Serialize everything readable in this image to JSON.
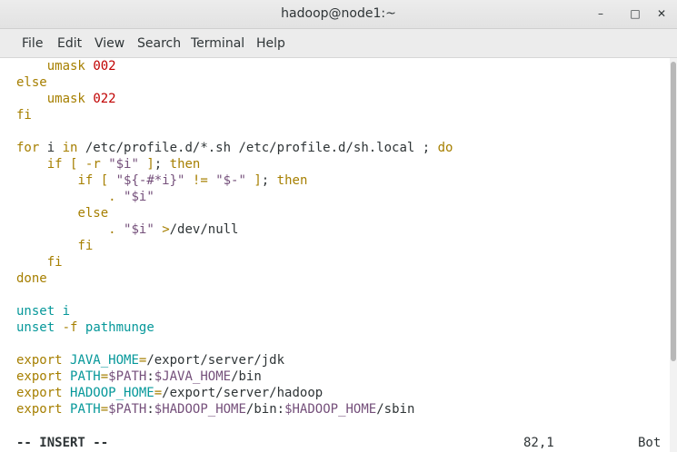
{
  "window": {
    "title": "hadoop@node1:~",
    "minimize": "–",
    "maximize": "□",
    "close": "✕"
  },
  "menu": [
    "File",
    "Edit",
    "View",
    "Search",
    "Terminal",
    "Help"
  ],
  "colors": {
    "keyword": "#a67f00",
    "builtin": "#06989a",
    "number": "#c00000",
    "string": "#75507b",
    "variable": "#75507b",
    "plain": "#2e3436"
  },
  "lines": [
    [
      {
        "t": "    "
      },
      {
        "t": "umask",
        "c": "keyword"
      },
      {
        "t": " "
      },
      {
        "t": "002",
        "c": "number"
      }
    ],
    [
      {
        "t": "else",
        "c": "keyword"
      }
    ],
    [
      {
        "t": "    "
      },
      {
        "t": "umask",
        "c": "keyword"
      },
      {
        "t": " "
      },
      {
        "t": "022",
        "c": "number"
      }
    ],
    [
      {
        "t": "fi",
        "c": "keyword"
      }
    ],
    [],
    [
      {
        "t": "for",
        "c": "keyword"
      },
      {
        "t": " i "
      },
      {
        "t": "in",
        "c": "keyword"
      },
      {
        "t": " /etc/profile.d/*.sh /etc/profile.d/sh.local ; "
      },
      {
        "t": "do",
        "c": "keyword"
      }
    ],
    [
      {
        "t": "    "
      },
      {
        "t": "if",
        "c": "keyword"
      },
      {
        "t": " "
      },
      {
        "t": "[",
        "c": "keyword"
      },
      {
        "t": " "
      },
      {
        "t": "-r",
        "c": "keyword"
      },
      {
        "t": " "
      },
      {
        "t": "\"$i\"",
        "c": "string"
      },
      {
        "t": " "
      },
      {
        "t": "]",
        "c": "keyword"
      },
      {
        "t": "; "
      },
      {
        "t": "then",
        "c": "keyword"
      }
    ],
    [
      {
        "t": "        "
      },
      {
        "t": "if",
        "c": "keyword"
      },
      {
        "t": " "
      },
      {
        "t": "[",
        "c": "keyword"
      },
      {
        "t": " "
      },
      {
        "t": "\"${-#*i}\"",
        "c": "string"
      },
      {
        "t": " "
      },
      {
        "t": "!=",
        "c": "keyword"
      },
      {
        "t": " "
      },
      {
        "t": "\"$-\"",
        "c": "string"
      },
      {
        "t": " "
      },
      {
        "t": "]",
        "c": "keyword"
      },
      {
        "t": "; "
      },
      {
        "t": "then",
        "c": "keyword"
      }
    ],
    [
      {
        "t": "            "
      },
      {
        "t": ".",
        "c": "keyword"
      },
      {
        "t": " "
      },
      {
        "t": "\"$i\"",
        "c": "string"
      }
    ],
    [
      {
        "t": "        "
      },
      {
        "t": "else",
        "c": "keyword"
      }
    ],
    [
      {
        "t": "            "
      },
      {
        "t": ".",
        "c": "keyword"
      },
      {
        "t": " "
      },
      {
        "t": "\"$i\"",
        "c": "string"
      },
      {
        "t": " "
      },
      {
        "t": ">",
        "c": "keyword"
      },
      {
        "t": "/dev/null"
      }
    ],
    [
      {
        "t": "        "
      },
      {
        "t": "fi",
        "c": "keyword"
      }
    ],
    [
      {
        "t": "    "
      },
      {
        "t": "fi",
        "c": "keyword"
      }
    ],
    [
      {
        "t": "done",
        "c": "keyword"
      }
    ],
    [],
    [
      {
        "t": "unset",
        "c": "builtin"
      },
      {
        "t": " "
      },
      {
        "t": "i",
        "c": "builtin"
      }
    ],
    [
      {
        "t": "unset",
        "c": "builtin"
      },
      {
        "t": " "
      },
      {
        "t": "-f",
        "c": "keyword"
      },
      {
        "t": " "
      },
      {
        "t": "pathmunge",
        "c": "builtin"
      }
    ],
    [],
    [
      {
        "t": "export",
        "c": "keyword"
      },
      {
        "t": " "
      },
      {
        "t": "JAVA_HOME",
        "c": "builtin"
      },
      {
        "t": "=",
        "c": "keyword"
      },
      {
        "t": "/export/server/jdk"
      }
    ],
    [
      {
        "t": "export",
        "c": "keyword"
      },
      {
        "t": " "
      },
      {
        "t": "PATH",
        "c": "builtin"
      },
      {
        "t": "=",
        "c": "keyword"
      },
      {
        "t": "$PATH",
        "c": "variable"
      },
      {
        "t": ":"
      },
      {
        "t": "$JAVA_HOME",
        "c": "variable"
      },
      {
        "t": "/bin"
      }
    ],
    [
      {
        "t": "export",
        "c": "keyword"
      },
      {
        "t": " "
      },
      {
        "t": "HADOOP_HOME",
        "c": "builtin"
      },
      {
        "t": "=",
        "c": "keyword"
      },
      {
        "t": "/export/server/hadoop"
      }
    ],
    [
      {
        "t": "export",
        "c": "keyword"
      },
      {
        "t": " "
      },
      {
        "t": "PATH",
        "c": "builtin"
      },
      {
        "t": "=",
        "c": "keyword"
      },
      {
        "t": "$PATH",
        "c": "variable"
      },
      {
        "t": ":"
      },
      {
        "t": "$HADOOP_HOME",
        "c": "variable"
      },
      {
        "t": "/bin:"
      },
      {
        "t": "$HADOOP_HOME",
        "c": "variable"
      },
      {
        "t": "/sbin"
      }
    ]
  ],
  "status": {
    "mode": "-- INSERT --",
    "position": "82,1",
    "scroll": "Bot"
  }
}
